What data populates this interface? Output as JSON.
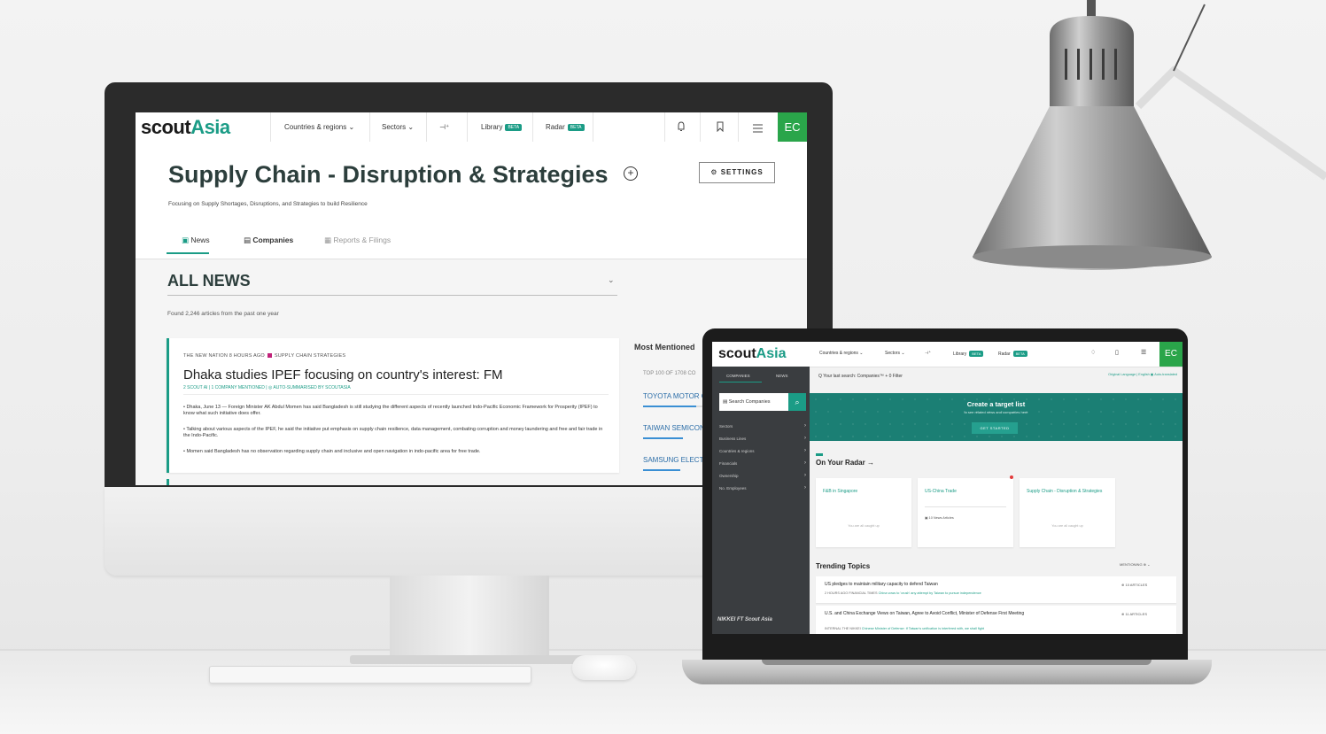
{
  "monitor": {
    "nav": {
      "logo_part1": "scout",
      "logo_part2": "Asia",
      "items": [
        "Countries & regions ⌄",
        "Sectors ⌄",
        "⊣⁺",
        "Library",
        "Radar"
      ],
      "beta": "BETA",
      "user_initials": "EC"
    },
    "page": {
      "title": "Supply Chain - Disruption & Strategies",
      "settings_label": "SETTINGS",
      "subtitle": "Focusing on Supply Shortages, Disruptions, and Strategies to build Resilience",
      "tabs": [
        "News",
        "Companies",
        "Reports & Filings"
      ]
    },
    "news": {
      "heading": "ALL NEWS",
      "found_text": "Found 2,246 articles from the past one year",
      "article": {
        "meta_source": "THE NEW NATION  8 HOURS AGO",
        "meta_tag": "SUPPLY CHAIN STRATEGIES",
        "headline": "Dhaka studies IPEF focusing on country's interest: FM",
        "submeta": "2 SCOUT AI  |  1 COMPANY MENTIONED  |  ◎ AUTO-SUMMARISED BY SCOUTASIA",
        "bullets": [
          "• Dhaka, June 13 — Foreign Minister AK Abdul Momen has said Bangladesh is still studying the different aspects of recently launched Indo-Pacific Economic Framework for Prosperity (IPEF) to know what such initiative does offer.",
          "• Talking about various aspects of the IPEF, he said the initiative put emphasis on supply chain resilience, data management, combating corruption and money laundering and free and fair trade in the Indo-Pacific.",
          "• Momen said Bangladesh has no observation regarding supply chain and inclusive and open navigation in indo-pacific area for free trade."
        ]
      }
    },
    "sidebar": {
      "title": "Most Mentioned",
      "top_label": "TOP 100 OF 1708 CO",
      "companies": [
        "TOYOTA MOTOR C",
        "TAIWAN SEMICON",
        "SAMSUNG ELECTR"
      ]
    }
  },
  "laptop": {
    "nav": {
      "logo_part1": "scout",
      "logo_part2": "Asia",
      "items": [
        "Countries & regions ⌄",
        "Sectors ⌄",
        "⊣⁺",
        "Library",
        "Radar"
      ],
      "beta": "BETA",
      "user_initials": "EC"
    },
    "sidebar": {
      "tabs": [
        "COMPANIES",
        "NEWS"
      ],
      "search_placeholder": "Search Companies",
      "filters": [
        "Sectors",
        "Business Lines",
        "Countries & regions",
        "Financials",
        "Ownership",
        "No. Employees"
      ],
      "footer": "NIKKEI  FT  Scout Asia"
    },
    "main": {
      "last_search": "Q  Your last search: Companies™ + 0 Filter",
      "language": "Original Language | English  ▣ Auto-translated",
      "banner": {
        "title": "Create a target list",
        "subtitle": "to see related news and companies here",
        "button": "GET STARTED"
      },
      "radar_title": "On Your Radar →",
      "radar_cards": [
        {
          "title": "F&B in Singapore",
          "status": "You are all caught up"
        },
        {
          "title": "US-China Trade",
          "status": "10 News Articles"
        },
        {
          "title": "Supply Chain - Disruption & Strategies",
          "status": "You are all caught up"
        }
      ],
      "trending_title": "Trending Topics",
      "trending_right": "MENTIONING  ⊕ ⌄",
      "topics": [
        {
          "title": "US pledges to maintain military capacity to defend Taiwan",
          "meta": "2 HOURS AGO   FINANCIAL TIMES",
          "meta_link": "China vows to 'crush' any attempt by Taiwan to pursue independence",
          "count": "⊕  10 ARTICLES"
        },
        {
          "title": "U.S. and China Exchange Views on Taiwan, Agree to Avoid Conflict, Minister of Defense First Meeting",
          "meta": "INTERNAL   THE NIKKEI",
          "meta_link": "Chinese Minister of Defense: If Taiwan's unification is interfered with, we shall fight",
          "count": "⊕  11 ARTICLES"
        }
      ]
    }
  }
}
